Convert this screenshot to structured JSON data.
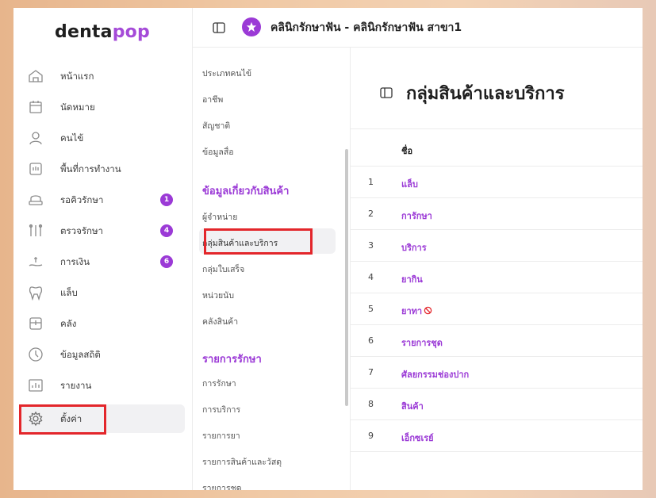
{
  "brand": {
    "logo_main": "denta",
    "logo_accent": "pop"
  },
  "header": {
    "title": "คลินิกรักษาฟัน - คลินิกรักษาฟัน สาขา1"
  },
  "sidebar": {
    "items": [
      {
        "label": "หน้าแรก",
        "icon": "home-icon"
      },
      {
        "label": "นัดหมาย",
        "icon": "calendar-icon"
      },
      {
        "label": "คนไข้",
        "icon": "user-icon"
      },
      {
        "label": "พื้นที่การทำงาน",
        "icon": "workspace-icon"
      },
      {
        "label": "รอคิวรักษา",
        "icon": "dental-chair-icon",
        "badge": "1"
      },
      {
        "label": "ตรวจรักษา",
        "icon": "dental-tools-icon",
        "badge": "4"
      },
      {
        "label": "การเงิน",
        "icon": "money-icon",
        "badge": "6"
      },
      {
        "label": "แล็บ",
        "icon": "tooth-icon"
      },
      {
        "label": "คลัง",
        "icon": "box-icon"
      },
      {
        "label": "ข้อมูลสถิติ",
        "icon": "stats-icon"
      },
      {
        "label": "รายงาน",
        "icon": "report-icon"
      },
      {
        "label": "ตั้งค่า",
        "icon": "gear-icon"
      }
    ]
  },
  "submenu": {
    "group1": [
      "ประเภทคนไข้",
      "อาชีพ",
      "สัญชาติ",
      "ข้อมูลสื่อ"
    ],
    "heading2": "ข้อมูลเกี่ยวกับสินค้า",
    "group2": [
      "ผู้จำหน่าย",
      "กลุ่มสินค้าและบริการ",
      "กลุ่มใบเสร็จ",
      "หน่วยนับ",
      "คลังสินค้า"
    ],
    "heading3": "รายการรักษา",
    "group3": [
      "การรักษา",
      "การบริการ",
      "รายการยา",
      "รายการสินค้าและวัสดุ",
      "รายการชุด"
    ]
  },
  "main": {
    "title": "กลุ่มสินค้าและบริการ",
    "column_name": "ชื่อ",
    "rows": [
      {
        "num": "1",
        "name": "แล็บ"
      },
      {
        "num": "2",
        "name": "การักษา"
      },
      {
        "num": "3",
        "name": "บริการ"
      },
      {
        "num": "4",
        "name": "ยากิน"
      },
      {
        "num": "5",
        "name": "ยาทา",
        "disabled_icon": "ban-icon"
      },
      {
        "num": "6",
        "name": "รายการชุด"
      },
      {
        "num": "7",
        "name": "ศัลยกรรมช่องปาก"
      },
      {
        "num": "8",
        "name": "สินค้า"
      },
      {
        "num": "9",
        "name": "เอ็กซเรย์"
      }
    ]
  },
  "colors": {
    "accent": "#9b3ad6",
    "highlight": "#e3262b"
  }
}
